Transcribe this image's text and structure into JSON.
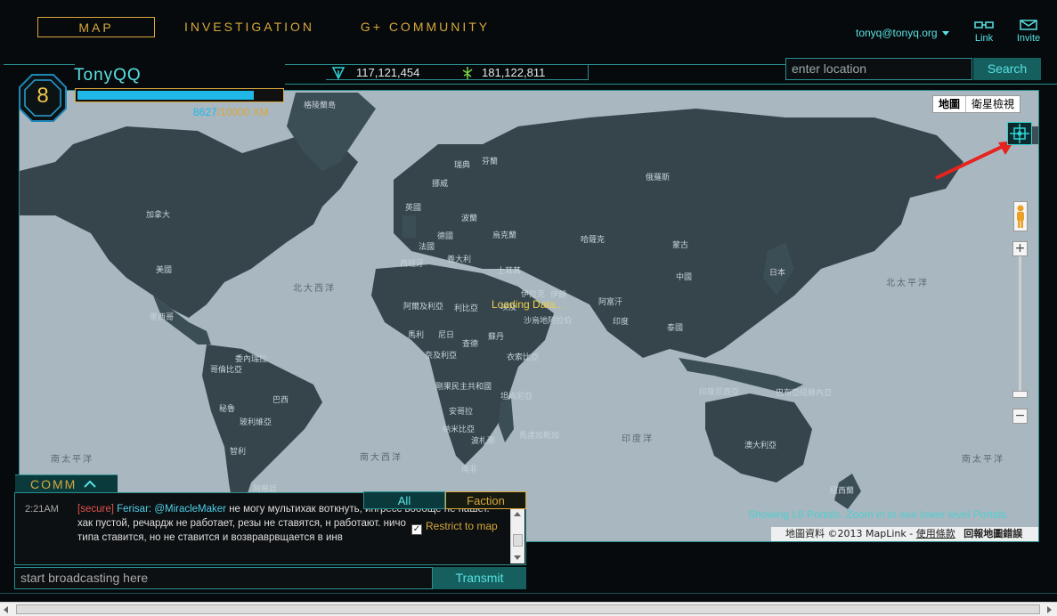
{
  "nav": {
    "tabs": [
      {
        "label": "MAP",
        "active": true
      },
      {
        "label": "INVESTIGATION",
        "active": false
      },
      {
        "label": "G+ COMMUNITY",
        "active": false
      }
    ],
    "account": "tonyq@tonyq.org",
    "link_label": "Link",
    "invite_label": "Invite"
  },
  "stats": {
    "enlightened": "117,121,454",
    "resistance": "181,122,811"
  },
  "search": {
    "placeholder": "enter location",
    "button": "Search"
  },
  "player": {
    "level": "8",
    "name": "TonyQQ",
    "xm_current": "8627",
    "xm_max": "/10000 XM",
    "xm_fraction": 0.8627
  },
  "map": {
    "type_map": "地圖",
    "type_satellite": "衛星檢視",
    "loading": "Loading Data...",
    "showing": "Showing L8 Portals. Zoom in to see lower level Portals.",
    "attribution": "地圖資料 ©2013 MapLink - ",
    "terms": "使用條款",
    "report": "回報地圖錯誤",
    "oceans": {
      "north_atlantic": "北大西洋",
      "north_pacific": "北太平洋",
      "south_pacific_w": "南太平洋",
      "south_atlantic": "南大西洋",
      "indian": "印度洋",
      "south_pacific_e": "南太平洋"
    },
    "labels": [
      "格陵蘭島",
      "瑞典",
      "挪威",
      "芬蘭",
      "俄羅斯",
      "英國",
      "波蘭",
      "德國",
      "烏克蘭",
      "法國",
      "哈薩克",
      "蒙古",
      "西班牙",
      "義大利",
      "土耳其",
      "中國",
      "日本",
      "加拿大",
      "美國",
      "墨西哥",
      "阿爾及利亞",
      "利比亞",
      "埃及",
      "伊朗",
      "伊拉克",
      "阿富汗",
      "沙烏地阿拉伯",
      "印度",
      "泰國",
      "馬利",
      "尼日",
      "查德",
      "蘇丹",
      "奈及利亞",
      "衣索比亞",
      "委內瑞拉",
      "哥倫比亞",
      "秘魯",
      "巴西",
      "玻利維亞",
      "剛果民主共和國",
      "坦尚尼亞",
      "安哥拉",
      "納米比亞",
      "波札那",
      "馬達加斯加",
      "南非",
      "印度尼西亞",
      "巴布亞紐幾內亞",
      "澳大利亞",
      "智利",
      "阿根廷",
      "紐西蘭"
    ]
  },
  "comm": {
    "tab_label": "COMM",
    "filter_all": "All",
    "filter_faction": "Faction",
    "restrict_label": "Restrict to map",
    "restrict_checked": true,
    "message": {
      "time": "2:21AM",
      "tag": "[secure]",
      "sender": "Ferisar:",
      "mention": "@MiracleMaker",
      "text": " не могу мультихак воткнуть, ингресс вообще не пашет. хак пустой, речардж не работает, резы не ставятся, н работают. ничо не работает)) оно типа ставится, но не ставится и возвраврвщается в инв"
    },
    "broadcast_placeholder": "start broadcasting here",
    "transmit": "Transmit"
  },
  "colors": {
    "cyan": "#59e1e3",
    "gold": "#d8a73b",
    "xp_fill": "#1fb8e8"
  }
}
